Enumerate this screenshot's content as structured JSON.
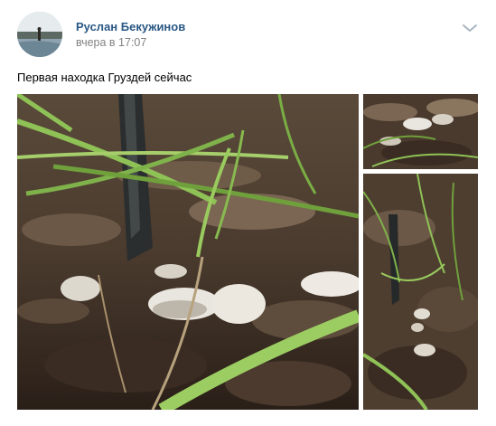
{
  "post": {
    "author": "Руслан Бекужинов",
    "date": "вчера в 17:07",
    "text": "Первая находка Груздей сейчас",
    "menu_icon": "chevron-down-icon"
  },
  "photos": [
    {
      "name": "main-photo",
      "subject": "mushrooms-with-knife"
    },
    {
      "name": "top-right-photo",
      "subject": "mushrooms-in-leaves"
    },
    {
      "name": "bottom-right-photo",
      "subject": "knife-in-grass"
    }
  ],
  "colors": {
    "author_link": "#2a5885",
    "date": "#828282",
    "soil": "#3a2c22",
    "grass": "#7fb24a"
  }
}
